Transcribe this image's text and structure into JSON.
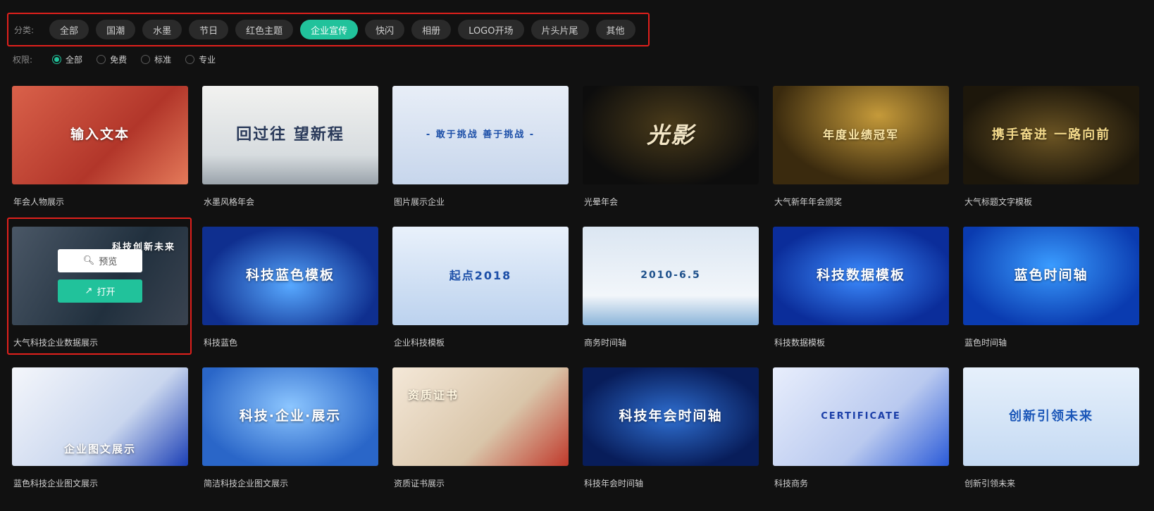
{
  "filters": {
    "label": "分类:",
    "categories": [
      "全部",
      "国潮",
      "水墨",
      "节日",
      "红色主题",
      "企业宣传",
      "快闪",
      "相册",
      "LOGO开场",
      "片头片尾",
      "其他"
    ],
    "active_index": 5
  },
  "permissions": {
    "label": "权限:",
    "options": [
      "全部",
      "免费",
      "标准",
      "专业"
    ],
    "selected_index": 0
  },
  "hover_actions": {
    "preview_label": "预览",
    "open_label": "打开"
  },
  "templates": [
    {
      "title": "年会人物展示",
      "thumb_text": "输入文本"
    },
    {
      "title": "水墨风格年会",
      "thumb_text": "回过往 望新程"
    },
    {
      "title": "图片展示企业",
      "thumb_text": "- 敢于挑战 善于挑战 -"
    },
    {
      "title": "光晕年会",
      "thumb_text": "光影"
    },
    {
      "title": "大气新年年会颁奖",
      "thumb_text": "年度业绩冠军"
    },
    {
      "title": "大气标题文字模板",
      "thumb_text": "携手奋进 一路向前"
    },
    {
      "title": "大气科技企业数据展示",
      "thumb_text": "科技创新未来"
    },
    {
      "title": "科技蓝色",
      "thumb_text": "科技蓝色模板"
    },
    {
      "title": "企业科技模板",
      "thumb_text": "起点2018"
    },
    {
      "title": "商务时间轴",
      "thumb_text": "2010-6.5"
    },
    {
      "title": "科技数据模板",
      "thumb_text": "科技数据模板"
    },
    {
      "title": "蓝色时间轴",
      "thumb_text": "蓝色时间轴"
    },
    {
      "title": "蓝色科技企业图文展示",
      "thumb_text": "企业图文展示"
    },
    {
      "title": "简洁科技企业图文展示",
      "thumb_text": "科技·企业·展示"
    },
    {
      "title": "资质证书展示",
      "thumb_text": "资质证书"
    },
    {
      "title": "科技年会时间轴",
      "thumb_text": "科技年会时间轴"
    },
    {
      "title": "科技商务",
      "thumb_text": "CERTIFICATE"
    },
    {
      "title": "创新引领未来",
      "thumb_text": "创新引领未来"
    }
  ]
}
